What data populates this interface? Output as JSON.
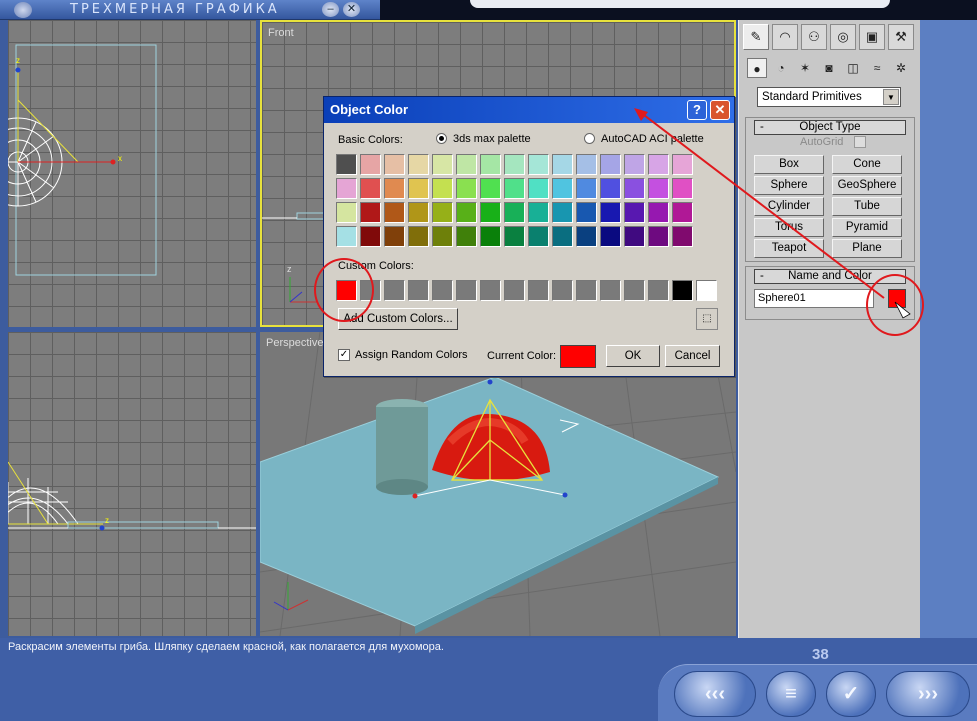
{
  "app": {
    "title": "ТРЕХМЕРНАЯ ГРАФИКА",
    "min_glyph": "–",
    "close_glyph": "✕"
  },
  "viewports": {
    "front_label": "Front",
    "perspective_label": "Perspective",
    "axis_x": "x",
    "axis_z": "z"
  },
  "command_panel": {
    "tabs": [
      {
        "icon": "create-icon",
        "glyph": "✎"
      },
      {
        "icon": "modify-icon",
        "glyph": "◠"
      },
      {
        "icon": "hierarchy-icon",
        "glyph": "⚇"
      },
      {
        "icon": "motion-icon",
        "glyph": "◎"
      },
      {
        "icon": "display-icon",
        "glyph": "▣"
      },
      {
        "icon": "utilities-icon",
        "glyph": "⚒"
      }
    ],
    "subtools": [
      {
        "icon": "geometry-icon",
        "glyph": "●"
      },
      {
        "icon": "shapes-icon",
        "glyph": "◔"
      },
      {
        "icon": "lights-icon",
        "glyph": "✶"
      },
      {
        "icon": "cameras-icon",
        "glyph": "◙"
      },
      {
        "icon": "helpers-icon",
        "glyph": "◫"
      },
      {
        "icon": "spacewarps-icon",
        "glyph": "≈"
      },
      {
        "icon": "systems-icon",
        "glyph": "✲"
      }
    ],
    "category_dropdown": "Standard Primitives",
    "object_type": {
      "header": "Object Type",
      "autogrid_label": "AutoGrid",
      "buttons": [
        "Box",
        "Cone",
        "Sphere",
        "GeoSphere",
        "Cylinder",
        "Tube",
        "Torus",
        "Pyramid",
        "Teapot",
        "Plane"
      ]
    },
    "name_and_color": {
      "header": "Name and Color",
      "name_value": "Sphere01",
      "color": "#ff0000"
    },
    "collapse_glyph": "-"
  },
  "dialog": {
    "title": "Object Color",
    "help_glyph": "?",
    "close_glyph": "✕",
    "basic_colors_label": "Basic Colors:",
    "palette_options": [
      {
        "label": "3ds max palette",
        "selected": true
      },
      {
        "label": "AutoCAD ACI palette",
        "selected": false
      }
    ],
    "basic_colors": [
      [
        "#4f4f4f",
        "#e6a5a5",
        "#e6bfa5",
        "#e6d7a5",
        "#d7e6a5",
        "#bfe6a5",
        "#a5e6a5",
        "#a5e6bf",
        "#a5e6d7",
        "#a5d7e6",
        "#a5bfe6",
        "#a5a5e6",
        "#bfa5e6",
        "#d7a5e6",
        "#e6a5d7"
      ],
      [
        "#e5a5d5",
        "#e05050",
        "#e08a50",
        "#e0c450",
        "#c4e050",
        "#8ae050",
        "#50e050",
        "#50e08a",
        "#50e0c4",
        "#50c4e0",
        "#508ae0",
        "#5050e0",
        "#8a50e0",
        "#c450e0",
        "#e050c4"
      ],
      [
        "#d5e5a0",
        "#b01818",
        "#b05818",
        "#b09618",
        "#96b018",
        "#58b018",
        "#18b018",
        "#18b058",
        "#18b096",
        "#1896b0",
        "#1858b0",
        "#1818b0",
        "#5818b0",
        "#9618b0",
        "#b01896"
      ],
      [
        "#a5e0e5",
        "#800a0a",
        "#80400a",
        "#806e0a",
        "#6e800a",
        "#40800a",
        "#0a800a",
        "#0a8040",
        "#0a806e",
        "#0a6e80",
        "#0a4080",
        "#0a0a80",
        "#400a80",
        "#6e0a80",
        "#800a6e"
      ]
    ],
    "custom_colors_label": "Custom Colors:",
    "custom_colors": [
      "#ff0000",
      "#7a7a7a",
      "#7a7a7a",
      "#7a7a7a",
      "#7a7a7a",
      "#7a7a7a",
      "#7a7a7a",
      "#7a7a7a",
      "#7a7a7a",
      "#7a7a7a",
      "#7a7a7a",
      "#7a7a7a",
      "#7a7a7a",
      "#7a7a7a",
      "#000000",
      "#ffffff"
    ],
    "add_custom_label": "Add Custom Colors...",
    "assign_random_label": "Assign Random Colors",
    "assign_random_checked": true,
    "checkmark": "✓",
    "current_color_label": "Current Color:",
    "current_color": "#ff0000",
    "ok_label": "OK",
    "cancel_label": "Cancel"
  },
  "status": {
    "text": "Раскрасим элементы гриба. Шляпку сделаем красной, как полагается для мухомора.",
    "page_number": "38"
  },
  "nav": {
    "prev_glyph": "‹‹‹",
    "menu_glyph": "≡",
    "check_glyph": "✓",
    "next_glyph": "›››"
  }
}
